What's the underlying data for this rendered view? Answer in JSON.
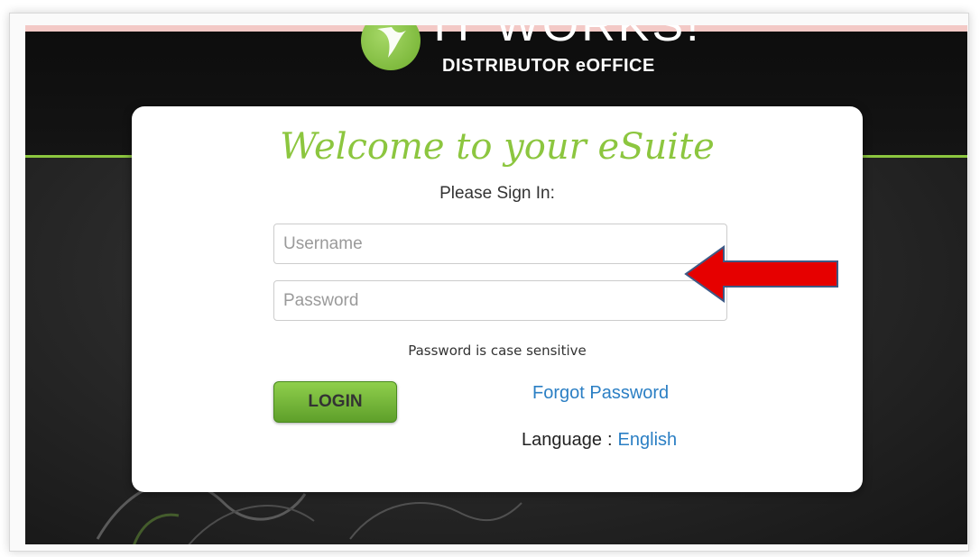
{
  "header": {
    "brand": "IT WORKS!",
    "subtitle": "DISTRIBUTOR eOFFICE"
  },
  "login_card": {
    "welcome": "Welcome to your eSuite",
    "prompt": "Please Sign In:",
    "username_placeholder": "Username",
    "password_placeholder": "Password",
    "case_note": "Password is case sensitive",
    "login_label": "LOGIN",
    "forgot_label": "Forgot Password",
    "language_label": "Language",
    "language_separator": ":",
    "language_value": "English"
  },
  "colors": {
    "accent_green": "#8cc63f",
    "link_blue": "#2b7fc4",
    "annotation_arrow": "#e60000"
  },
  "icons": {
    "logo": "leaf-logo-icon",
    "annotation": "red-arrow-icon"
  }
}
